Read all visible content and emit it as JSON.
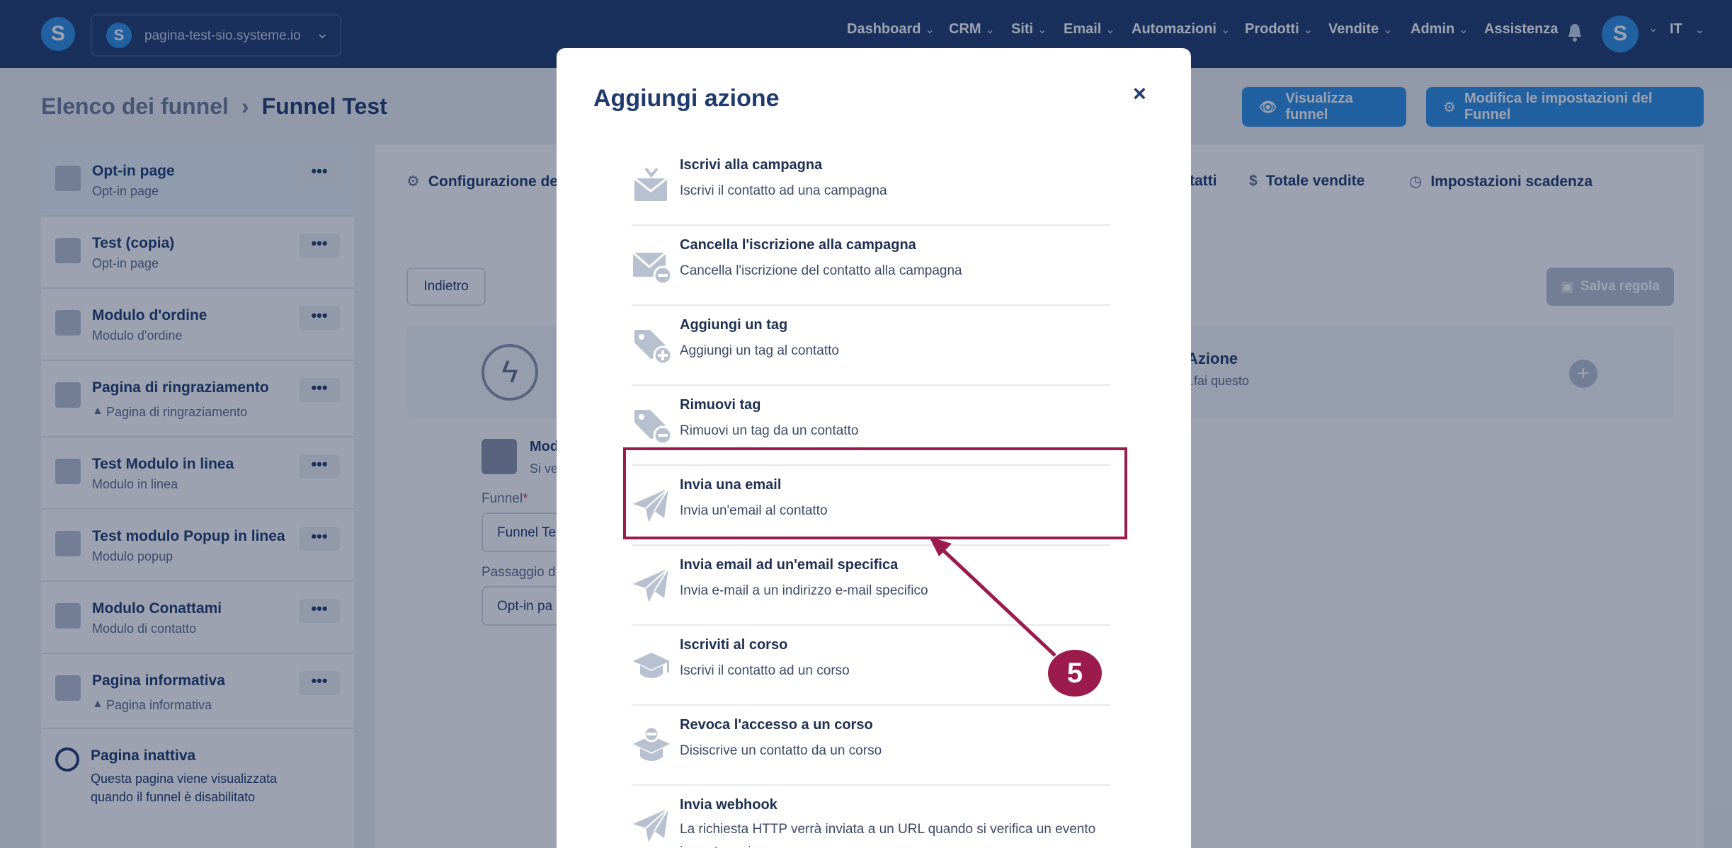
{
  "header": {
    "site": "pagina-test-sio.systeme.io",
    "nav": [
      "Dashboard",
      "CRM",
      "Siti",
      "Email",
      "Automazioni",
      "Prodotti",
      "Vendite",
      "Admin"
    ],
    "help": "Assistenza",
    "language": "IT",
    "logo_letter": "S"
  },
  "breadcrumb": {
    "parent": "Elenco dei funnel",
    "current": "Funnel Test"
  },
  "buttons": {
    "view_funnel": "Visualizza funnel",
    "edit_settings": "Modifica le impostazioni del Funnel",
    "back": "Indietro",
    "save_rule": "Salva regola"
  },
  "sidebar": {
    "items": [
      {
        "title": "Opt-in page",
        "subtitle": "Opt-in page"
      },
      {
        "title": "Test (copia)",
        "subtitle": "Opt-in page"
      },
      {
        "title": "Modulo d'ordine",
        "subtitle": "Modulo d'ordine"
      },
      {
        "title": "Pagina di ringraziamento",
        "subtitle": "Pagina di ringraziamento"
      },
      {
        "title": "Test Modulo in linea",
        "subtitle": "Modulo in linea"
      },
      {
        "title": "Test modulo Popup in linea",
        "subtitle": "Modulo popup"
      },
      {
        "title": "Modulo Conatta­mi",
        "subtitle": "Modulo di contatto"
      },
      {
        "title": "Pagina informativa",
        "subtitle": "Pagina informativa"
      }
    ],
    "inactive": {
      "title": "Pagina inattiva",
      "line1": "Questa pagina viene visualizzata",
      "line2": "quando il funnel è disabilitato"
    },
    "dots": "•••"
  },
  "tabs": {
    "config": "Configurazione de",
    "contacts": "tatti",
    "sales": "Totale vendite",
    "deadline": "Impostazioni scadenza"
  },
  "rule": {
    "action_title": "Azione",
    "action_sub": "..fai questo",
    "module_title": "Mod",
    "module_sub": "Si ve"
  },
  "fields": {
    "funnel_label": "Funnel",
    "funnel_value": "Funnel Te",
    "step_label": "Passaggio d",
    "step_value": "Opt-in pa"
  },
  "modal": {
    "title": "Aggiungi azione",
    "close": "×",
    "actions": [
      {
        "icon": "campaign-subscribe-icon",
        "title": "Iscrivi alla campagna",
        "desc": "Iscrivi il contatto ad una campagna"
      },
      {
        "icon": "campaign-unsubscribe-icon",
        "title": "Cancella l'iscrizione alla campagna",
        "desc": "Cancella l'iscrizione del contatto alla campagna"
      },
      {
        "icon": "tag-add-icon",
        "title": "Aggiungi un tag",
        "desc": "Aggiungi un tag al contatto"
      },
      {
        "icon": "tag-remove-icon",
        "title": "Rimuovi tag",
        "desc": "Rimuovi un tag da un contatto"
      },
      {
        "icon": "send-email-icon",
        "title": "Invia una email",
        "desc": "Invia un'email al contatto"
      },
      {
        "icon": "send-specific-email-icon",
        "title": "Invia email ad un'email specifica",
        "desc": "Invia e-mail a un indirizzo e-mail specifico"
      },
      {
        "icon": "course-enroll-icon",
        "title": "Iscriviti al corso",
        "desc": "Iscrivi il contatto ad un corso"
      },
      {
        "icon": "course-revoke-icon",
        "title": "Revoca l'accesso a un corso",
        "desc": "Disiscrive un contatto da un corso"
      },
      {
        "icon": "webhook-icon",
        "title": "Invia webhook",
        "desc": "La richiesta HTTP verrà inviata a un URL quando si verifica un evento in systeme.io"
      }
    ]
  },
  "annotation": {
    "step": "5",
    "color": "#9b1b4c"
  }
}
